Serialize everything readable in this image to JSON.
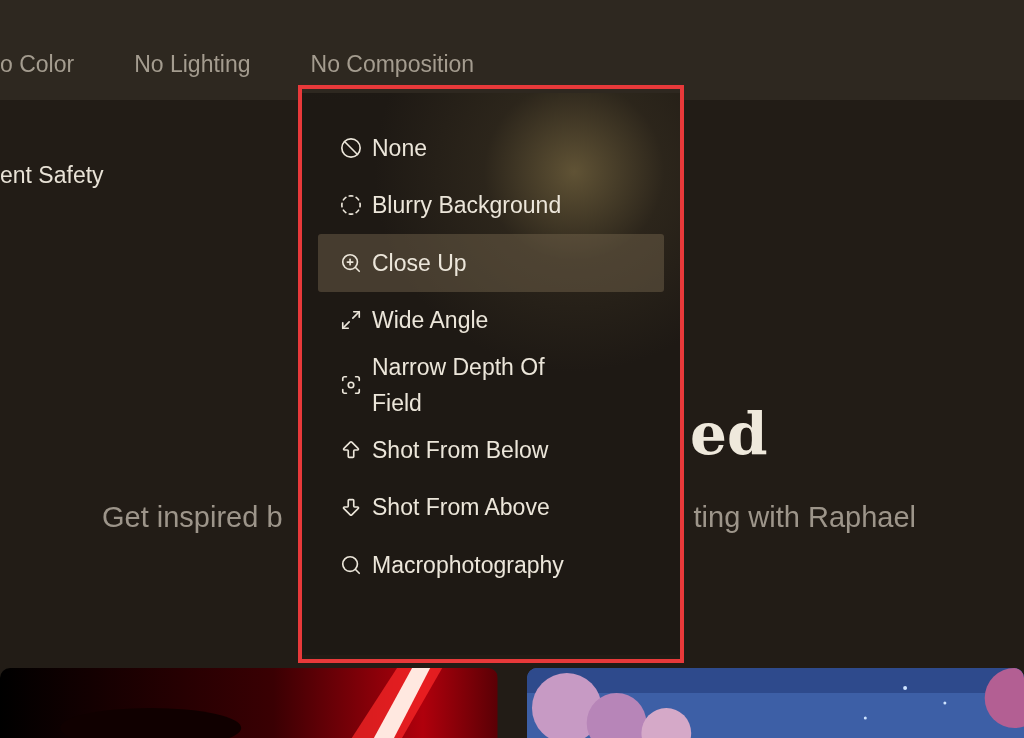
{
  "filter_bar": {
    "items": [
      "o Color",
      "No Lighting",
      "No Composition"
    ]
  },
  "side_label": "ent Safety",
  "heading": "ed",
  "subtitle": {
    "left": "Get inspired b",
    "right": "ting with Raphael"
  },
  "composition_menu": {
    "items": [
      {
        "label": "None",
        "selected": false
      },
      {
        "label": "Blurry Background",
        "selected": false
      },
      {
        "label": "Close Up",
        "selected": true
      },
      {
        "label": "Wide Angle",
        "selected": false
      },
      {
        "label": "Narrow Depth Of Field",
        "selected": false
      },
      {
        "label": "Shot From Below",
        "selected": false
      },
      {
        "label": "Shot From Above",
        "selected": false
      },
      {
        "label": "Macrophotography",
        "selected": false
      }
    ]
  }
}
